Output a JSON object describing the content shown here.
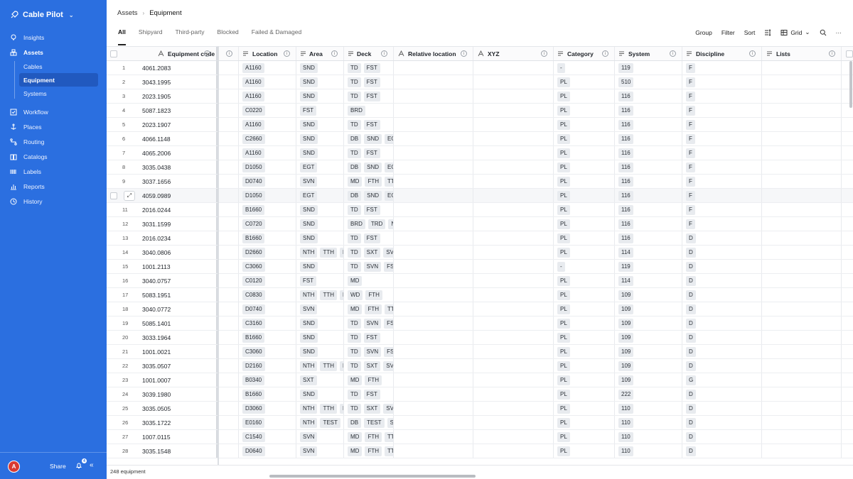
{
  "app": {
    "name": "Cable Pilot"
  },
  "sidebar": {
    "items": [
      {
        "label": "Insights",
        "icon": "bulb-icon"
      },
      {
        "label": "Assets",
        "icon": "boxes-icon"
      },
      {
        "label": "Workflow",
        "icon": "checklist-icon"
      },
      {
        "label": "Places",
        "icon": "anchor-icon"
      },
      {
        "label": "Routing",
        "icon": "route-icon"
      },
      {
        "label": "Catalogs",
        "icon": "book-icon"
      },
      {
        "label": "Labels",
        "icon": "barcode-icon"
      },
      {
        "label": "Reports",
        "icon": "chart-icon"
      },
      {
        "label": "History",
        "icon": "clock-icon"
      }
    ],
    "sub_items": [
      "Cables",
      "Equipment",
      "Systems"
    ],
    "avatar_initial": "A",
    "share_label": "Share",
    "notification_count": "4"
  },
  "breadcrumb": {
    "parent": "Assets",
    "current": "Equipment"
  },
  "tabs": [
    "All",
    "Shipyard",
    "Third-party",
    "Blocked",
    "Failed & Damaged"
  ],
  "toolbar": {
    "group": "Group",
    "filter": "Filter",
    "sort": "Sort",
    "view": "Grid"
  },
  "columns": {
    "code": "Equipment code",
    "location": "Location",
    "area": "Area",
    "deck": "Deck",
    "rel": "Relative location",
    "xyz": "XYZ",
    "category": "Category",
    "system": "System",
    "discipline": "Discipline",
    "lists": "Lists"
  },
  "rows": [
    {
      "n": "1",
      "code": "4061.2083",
      "loc": "A1160",
      "area": [
        "SND"
      ],
      "deck": [
        "TD",
        "FST"
      ],
      "cat": "-",
      "sys": "119",
      "disc": "F"
    },
    {
      "n": "2",
      "code": "3043.1995",
      "loc": "A1160",
      "area": [
        "SND"
      ],
      "deck": [
        "TD",
        "FST"
      ],
      "cat": "PL",
      "sys": "510",
      "disc": "F"
    },
    {
      "n": "3",
      "code": "2023.1905",
      "loc": "A1160",
      "area": [
        "SND"
      ],
      "deck": [
        "TD",
        "FST"
      ],
      "cat": "PL",
      "sys": "116",
      "disc": "F"
    },
    {
      "n": "4",
      "code": "5087.1823",
      "loc": "C0220",
      "area": [
        "FST"
      ],
      "deck": [
        "BRD"
      ],
      "cat": "PL",
      "sys": "116",
      "disc": "F"
    },
    {
      "n": "5",
      "code": "2023.1907",
      "loc": "A1160",
      "area": [
        "SND"
      ],
      "deck": [
        "TD",
        "FST"
      ],
      "cat": "PL",
      "sys": "116",
      "disc": "F"
    },
    {
      "n": "6",
      "code": "4066.1148",
      "loc": "C2660",
      "area": [
        "SND"
      ],
      "deck": [
        "DB",
        "SND",
        "EGT"
      ],
      "cat": "PL",
      "sys": "116",
      "disc": "F"
    },
    {
      "n": "7",
      "code": "4065.2006",
      "loc": "A1160",
      "area": [
        "SND"
      ],
      "deck": [
        "TD",
        "FST"
      ],
      "cat": "PL",
      "sys": "116",
      "disc": "F"
    },
    {
      "n": "8",
      "code": "3035.0438",
      "loc": "D1050",
      "area": [
        "EGT"
      ],
      "deck": [
        "DB",
        "SND",
        "EGT"
      ],
      "cat": "PL",
      "sys": "116",
      "disc": "F"
    },
    {
      "n": "9",
      "code": "3037.1656",
      "loc": "D0740",
      "area": [
        "SVN"
      ],
      "deck": [
        "MD",
        "FTH",
        "TTH"
      ],
      "cat": "PL",
      "sys": "116",
      "disc": "F"
    },
    {
      "n": "",
      "code": "4059.0989",
      "loc": "D1050",
      "area": [
        "EGT"
      ],
      "deck": [
        "DB",
        "SND",
        "EGT"
      ],
      "cat": "PL",
      "sys": "116",
      "disc": "F"
    },
    {
      "n": "11",
      "code": "2016.0244",
      "loc": "B1660",
      "area": [
        "SND"
      ],
      "deck": [
        "TD",
        "FST"
      ],
      "cat": "PL",
      "sys": "116",
      "disc": "F"
    },
    {
      "n": "12",
      "code": "3031.1599",
      "loc": "C0720",
      "area": [
        "SND"
      ],
      "deck": [
        "BRD",
        "TRD",
        "NT"
      ],
      "cat": "PL",
      "sys": "116",
      "disc": "F"
    },
    {
      "n": "13",
      "code": "2016.0234",
      "loc": "B1660",
      "area": [
        "SND"
      ],
      "deck": [
        "TD",
        "FST"
      ],
      "cat": "PL",
      "sys": "116",
      "disc": "D"
    },
    {
      "n": "14",
      "code": "3040.0806",
      "loc": "D2660",
      "area": [
        "NTH",
        "TTH",
        "D"
      ],
      "deck": [
        "TD",
        "SXT",
        "SVN"
      ],
      "cat": "PL",
      "sys": "114",
      "disc": "D"
    },
    {
      "n": "15",
      "code": "1001.2113",
      "loc": "C3060",
      "area": [
        "SND"
      ],
      "deck": [
        "TD",
        "SVN",
        "FST"
      ],
      "cat": "-",
      "sys": "119",
      "disc": "D"
    },
    {
      "n": "16",
      "code": "3040.0757",
      "loc": "C0120",
      "area": [
        "FST"
      ],
      "deck": [
        "MD"
      ],
      "cat": "PL",
      "sys": "114",
      "disc": "D"
    },
    {
      "n": "17",
      "code": "5083.1951",
      "loc": "C0830",
      "area": [
        "NTH",
        "TTH",
        "D"
      ],
      "deck": [
        "WD",
        "FTH"
      ],
      "cat": "PL",
      "sys": "109",
      "disc": "D"
    },
    {
      "n": "18",
      "code": "3040.0772",
      "loc": "D0740",
      "area": [
        "SVN"
      ],
      "deck": [
        "MD",
        "FTH",
        "TTH"
      ],
      "cat": "PL",
      "sys": "109",
      "disc": "D"
    },
    {
      "n": "19",
      "code": "5085.1401",
      "loc": "C3160",
      "area": [
        "SND"
      ],
      "deck": [
        "TD",
        "SVN",
        "FST"
      ],
      "cat": "PL",
      "sys": "109",
      "disc": "D"
    },
    {
      "n": "20",
      "code": "3033.1964",
      "loc": "B1660",
      "area": [
        "SND"
      ],
      "deck": [
        "TD",
        "FST"
      ],
      "cat": "PL",
      "sys": "109",
      "disc": "D"
    },
    {
      "n": "21",
      "code": "1001.0021",
      "loc": "C3060",
      "area": [
        "SND"
      ],
      "deck": [
        "TD",
        "SVN",
        "FST"
      ],
      "cat": "PL",
      "sys": "109",
      "disc": "D"
    },
    {
      "n": "22",
      "code": "3035.0507",
      "loc": "D2160",
      "area": [
        "NTH",
        "TTH",
        "D"
      ],
      "deck": [
        "TD",
        "SXT",
        "SVN"
      ],
      "cat": "PL",
      "sys": "109",
      "disc": "D"
    },
    {
      "n": "23",
      "code": "1001.0007",
      "loc": "B0340",
      "area": [
        "SXT"
      ],
      "deck": [
        "MD",
        "FTH"
      ],
      "cat": "PL",
      "sys": "109",
      "disc": "G"
    },
    {
      "n": "24",
      "code": "3039.1980",
      "loc": "B1660",
      "area": [
        "SND"
      ],
      "deck": [
        "TD",
        "FST"
      ],
      "cat": "PL",
      "sys": "222",
      "disc": "D"
    },
    {
      "n": "25",
      "code": "3035.0505",
      "loc": "D3060",
      "area": [
        "NTH",
        "TTH",
        "D"
      ],
      "deck": [
        "TD",
        "SXT",
        "SVN"
      ],
      "cat": "PL",
      "sys": "110",
      "disc": "D"
    },
    {
      "n": "26",
      "code": "3035.1722",
      "loc": "E0160",
      "area": [
        "NTH",
        "TEST",
        "T"
      ],
      "deck": [
        "DB",
        "TEST",
        "SNI"
      ],
      "cat": "PL",
      "sys": "110",
      "disc": "D"
    },
    {
      "n": "27",
      "code": "1007.0115",
      "loc": "C1540",
      "area": [
        "SVN"
      ],
      "deck": [
        "MD",
        "FTH",
        "TTH"
      ],
      "cat": "PL",
      "sys": "110",
      "disc": "D"
    },
    {
      "n": "28",
      "code": "3035.1548",
      "loc": "D0640",
      "area": [
        "SVN"
      ],
      "deck": [
        "MD",
        "FTH",
        "TTH"
      ],
      "cat": "PL",
      "sys": "110",
      "disc": "D"
    }
  ],
  "footer": {
    "count": "248 equipment"
  }
}
